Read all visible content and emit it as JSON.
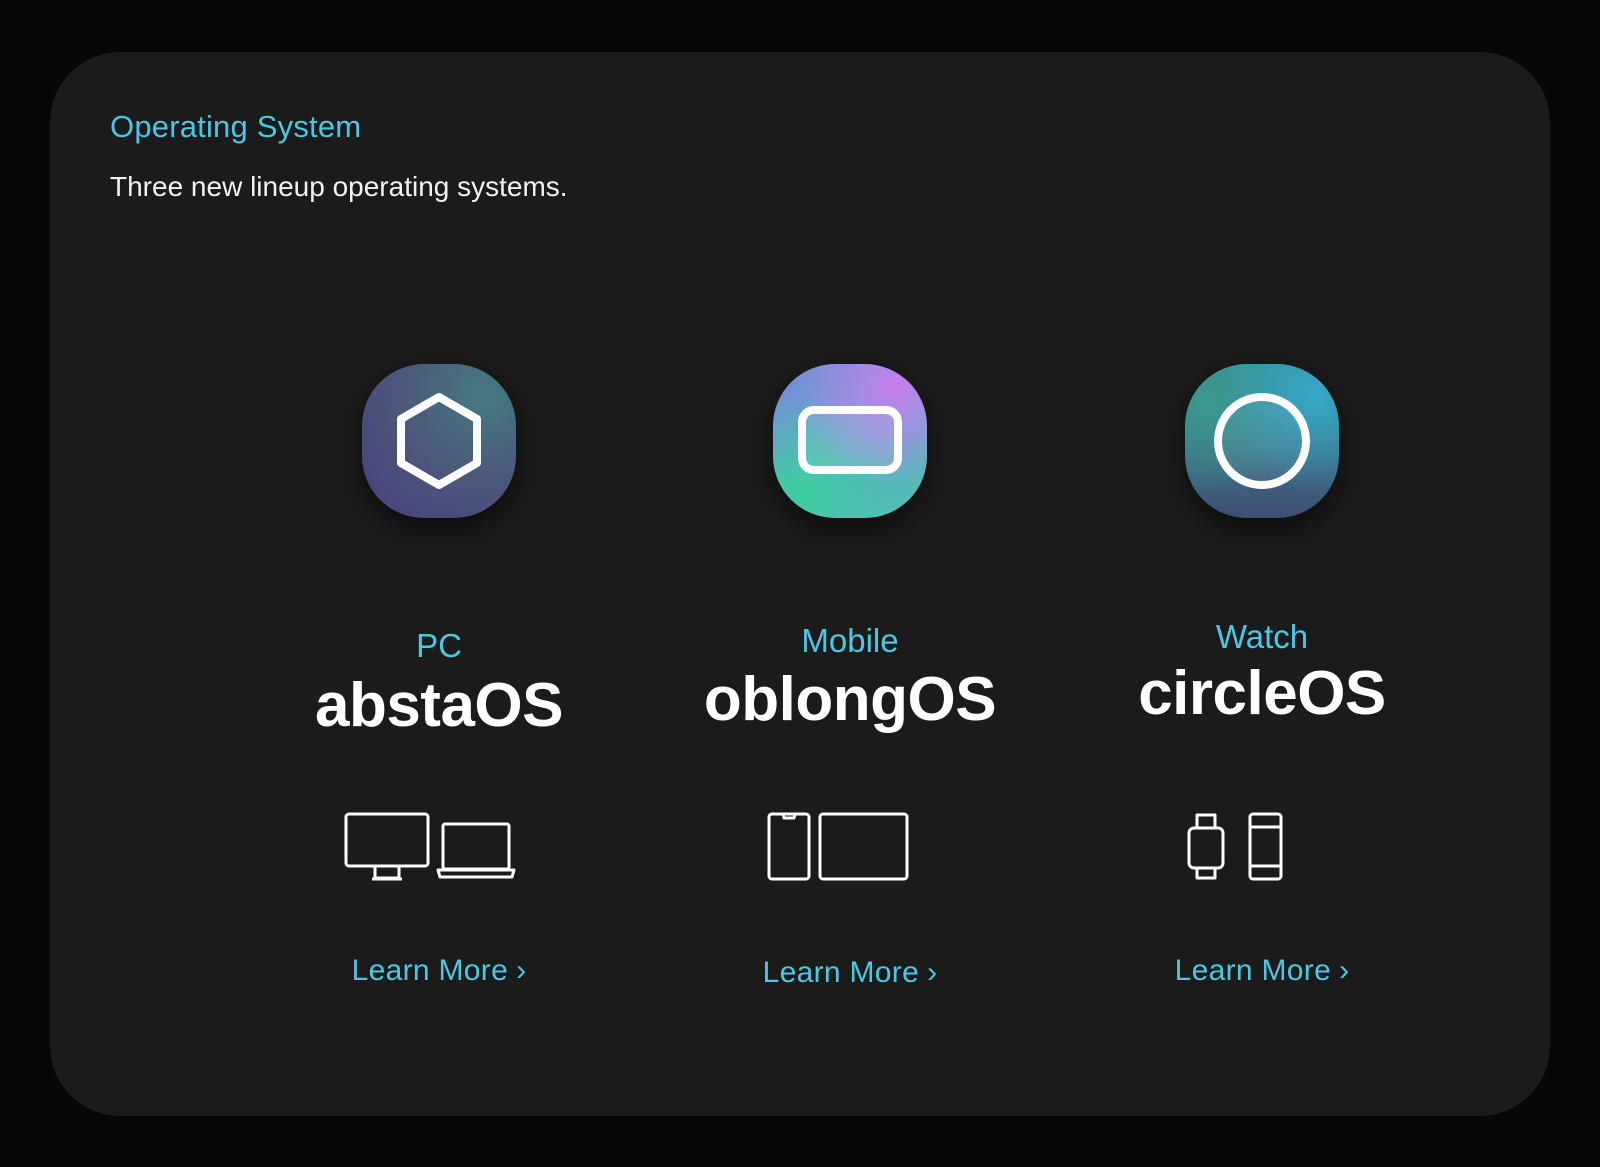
{
  "header": {
    "eyebrow": "Operating System",
    "subtitle": "Three new lineup operating systems."
  },
  "products": [
    {
      "category": "PC",
      "name": "abstaOS",
      "icon": "hexagon-icon",
      "devices": [
        "desktop-monitor-icon",
        "laptop-icon"
      ],
      "link_label": "Learn More",
      "link_chevron": "›"
    },
    {
      "category": "Mobile",
      "name": "oblongOS",
      "icon": "rounded-rectangle-icon",
      "devices": [
        "phone-icon",
        "tablet-icon"
      ],
      "link_label": "Learn More",
      "link_chevron": "›"
    },
    {
      "category": "Watch",
      "name": "circleOS",
      "icon": "circle-icon",
      "devices": [
        "watch-icon",
        "watch-band-icon"
      ],
      "link_label": "Learn More",
      "link_chevron": "›"
    }
  ],
  "colors": {
    "accent": "#4ec6e2",
    "card_background": "#1b1b1b",
    "page_background": "#070707",
    "text": "#ffffff"
  }
}
